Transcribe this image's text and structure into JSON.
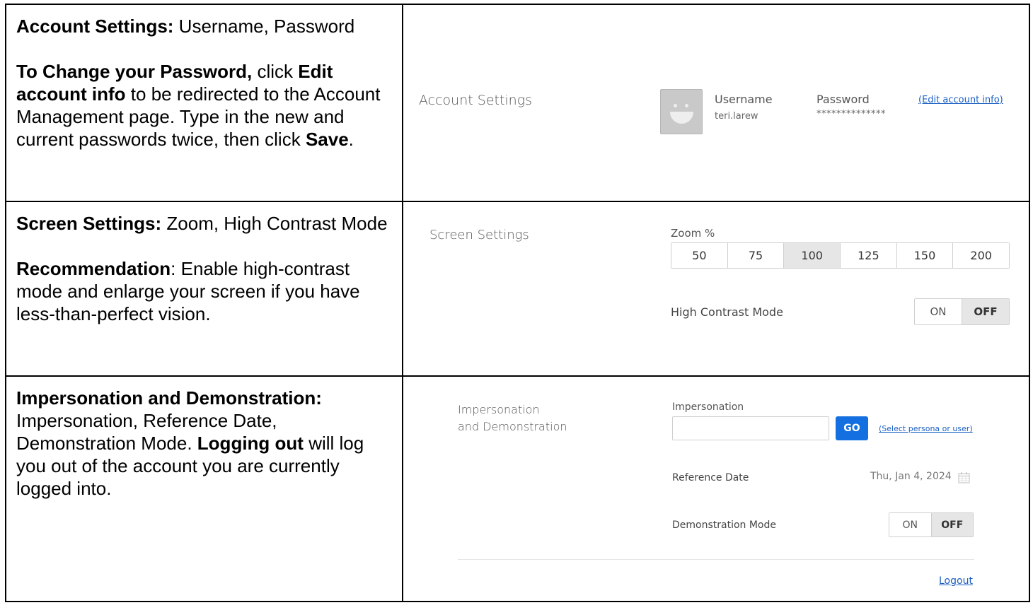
{
  "instructions": {
    "account": {
      "title": "Account Settings:",
      "title_rest": " Username, Password",
      "change_bold": "To Change your Password,",
      "change_mid1": " click ",
      "edit_bold": "Edit account info",
      "change_mid2": " to be redirected to the Account Management page. Type in the new and current passwords twice, then click ",
      "save_bold": "Save",
      "change_end": "."
    },
    "screen": {
      "title": "Screen Settings:",
      "title_rest": " Zoom, High Contrast Mode",
      "rec_bold": "Recommendation",
      "rec_rest": ": Enable high-contrast mode and enlarge your screen if you have less-than-perfect vision."
    },
    "impersonation": {
      "title": "Impersonation and Demonstration:",
      "title_rest": " Impersonation, Reference Date, Demonstration Mode. ",
      "logout_bold": "Logging out",
      "logout_rest": " will log you out of the account you are currently logged into."
    }
  },
  "account_panel": {
    "section_title": "Account Settings",
    "username_label": "Username",
    "username_value": "teri.larew",
    "password_label": "Password",
    "password_value": "**************",
    "edit_link": "(Edit account info)"
  },
  "screen_panel": {
    "section_title": "Screen Settings",
    "zoom_label": "Zoom %",
    "zoom_options": [
      "50",
      "75",
      "100",
      "125",
      "150",
      "200"
    ],
    "zoom_selected": "100",
    "contrast_label": "High Contrast Mode",
    "toggle_on": "ON",
    "toggle_off": "OFF",
    "contrast_state": "OFF"
  },
  "impersonation_panel": {
    "section_title_line1": "Impersonation",
    "section_title_line2": "and Demonstration",
    "impersonation_label": "Impersonation",
    "impersonation_value": "",
    "go_label": "GO",
    "select_link": "(Select persona or user)",
    "reference_label": "Reference Date",
    "reference_value": "Thu, Jan 4, 2024",
    "demo_label": "Demonstration Mode",
    "toggle_on": "ON",
    "toggle_off": "OFF",
    "demo_state": "OFF",
    "logout_link": "Logout"
  },
  "colors": {
    "link": "#1a5fc4",
    "go_button": "#1470e0",
    "selected_bg": "#e6e6e6"
  }
}
